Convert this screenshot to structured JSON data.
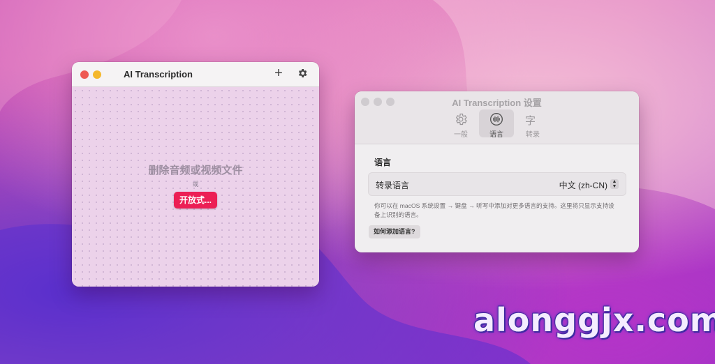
{
  "left_window": {
    "title": "AI Transcription",
    "add_icon": "plus-icon",
    "settings_icon": "gear-icon",
    "drop_title": "删除音频或视频文件",
    "or_text": "或",
    "open_button": "开放式..."
  },
  "settings_window": {
    "title": "AI Transcription 设置",
    "tabs": [
      {
        "label": "一般",
        "icon": "gear-icon"
      },
      {
        "label": "语言",
        "icon": "waveform-icon"
      },
      {
        "label": "转录",
        "icon": "text-cursor-icon",
        "glyph": "字"
      }
    ],
    "section_title": "语言",
    "row_label": "转录语言",
    "row_value": "中文 (zh-CN)",
    "hint": "你可以在 macOS 系统设置 → 键盘 → 听写中添加对更多语言的支持。这里将只显示支持设备上识别的语言。",
    "help_button": "如何添加语言?"
  },
  "watermark": "alonggjx.com",
  "colors": {
    "accent_red": "#ec1f55",
    "close_red": "#ee5a52",
    "minimize_yellow": "#f4b82c"
  }
}
